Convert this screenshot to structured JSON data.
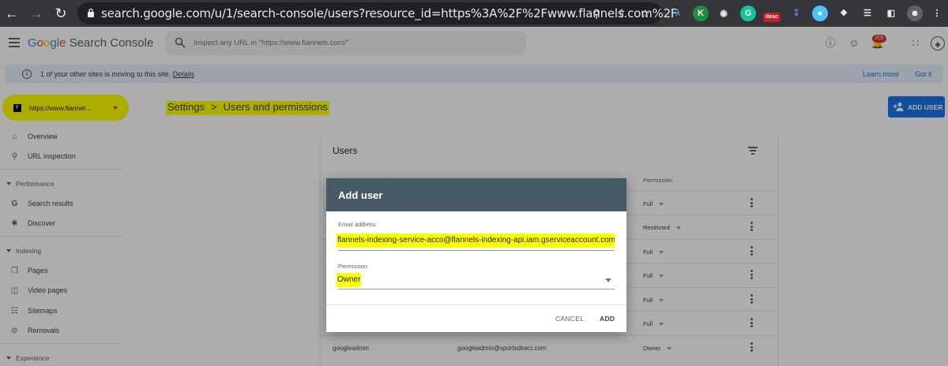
{
  "browser": {
    "url": "search.google.com/u/1/search-console/users?resource_id=https%3A%2F%2Fwww.flannels.com%2F",
    "extensions": [
      "desc"
    ]
  },
  "header": {
    "logo_google": [
      "G",
      "o",
      "o",
      "g",
      "l",
      "e"
    ],
    "logo_product": "Search Console",
    "search_placeholder": "Inspect any URL in \"https://www.flannels.com/\"",
    "notification_count": "205"
  },
  "banner": {
    "text": "1 of your other sites is moving to this site.",
    "details_link": "Details",
    "learn_more": "Learn more",
    "got_it": "Got it"
  },
  "property": {
    "favicon_letter": "F",
    "label": "https://www.flannel..."
  },
  "breadcrumb": {
    "settings": "Settings",
    "separator": ">",
    "current": "Users and permissions"
  },
  "add_user_button": "ADD USER",
  "sidebar": {
    "items": [
      {
        "label": "Overview",
        "icon": "home-icon"
      },
      {
        "label": "URL inspection",
        "icon": "search-icon"
      }
    ],
    "performance": {
      "title": "Performance",
      "items": [
        {
          "label": "Search results",
          "icon": "google-g-icon"
        },
        {
          "label": "Discover",
          "icon": "asterisk-icon"
        }
      ]
    },
    "indexing": {
      "title": "Indexing",
      "items": [
        {
          "label": "Pages",
          "icon": "pages-icon"
        },
        {
          "label": "Video pages",
          "icon": "video-pages-icon"
        },
        {
          "label": "Sitemaps",
          "icon": "sitemap-icon"
        },
        {
          "label": "Removals",
          "icon": "removals-icon"
        }
      ]
    },
    "experience": {
      "title": "Experience"
    }
  },
  "users_card": {
    "title": "Users",
    "permission_header": "Permission",
    "rows": [
      {
        "name": "",
        "email": "",
        "permission": "Full"
      },
      {
        "name": "",
        "email": "",
        "permission": "Restricted"
      },
      {
        "name": "",
        "email": "",
        "permission": "Full"
      },
      {
        "name": "",
        "email": "",
        "permission": "Full"
      },
      {
        "name": "",
        "email": "",
        "permission": "Full"
      },
      {
        "name": "",
        "email": "",
        "permission": "Full"
      },
      {
        "name": "googleadmin",
        "email": "googleadmin@sportsdirect.com",
        "permission": "Owner"
      }
    ]
  },
  "modal": {
    "title": "Add user",
    "email_label": "Email address",
    "email_value": "flannels-indexing-service-acco@flannels-indexing-api.iam.gserviceaccount.com",
    "permission_label": "Permission",
    "permission_value": "Owner",
    "cancel": "CANCEL",
    "add": "ADD"
  },
  "colors": {
    "highlight": "#ffff00",
    "modal_header": "#455a64",
    "primary_button": "#1a73e8",
    "banner_bg": "#e8f0fe"
  }
}
